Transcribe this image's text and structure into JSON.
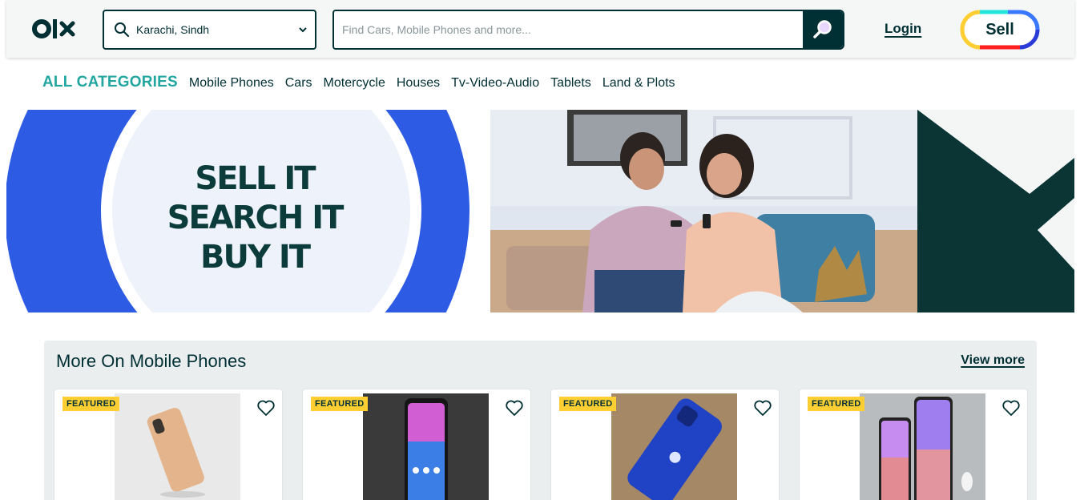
{
  "header": {
    "logo": "olx",
    "location": "Karachi, Sindh",
    "search_placeholder": "Find Cars, Mobile Phones and more...",
    "login_label": "Login",
    "sell_label": "Sell"
  },
  "categories": {
    "all_label": "ALL CATEGORIES",
    "items": [
      "Mobile Phones",
      "Cars",
      "Motercycle",
      "Houses",
      "Tv-Video-Audio",
      "Tablets",
      "Land & Plots"
    ]
  },
  "banner": {
    "lines": [
      "SELL IT",
      "SEARCH IT",
      "BUY IT"
    ]
  },
  "section": {
    "title": "More On Mobile Phones",
    "view_more": "View more",
    "cards": [
      {
        "badge": "FEATURED"
      },
      {
        "badge": "FEATURED"
      },
      {
        "badge": "FEATURED"
      },
      {
        "badge": "FEATURED"
      }
    ]
  },
  "colors": {
    "brand_dark": "#002f34",
    "category_accent": "#23a6a0",
    "featured_badge": "#ffce32",
    "banner_blue": "#2d5be3"
  }
}
